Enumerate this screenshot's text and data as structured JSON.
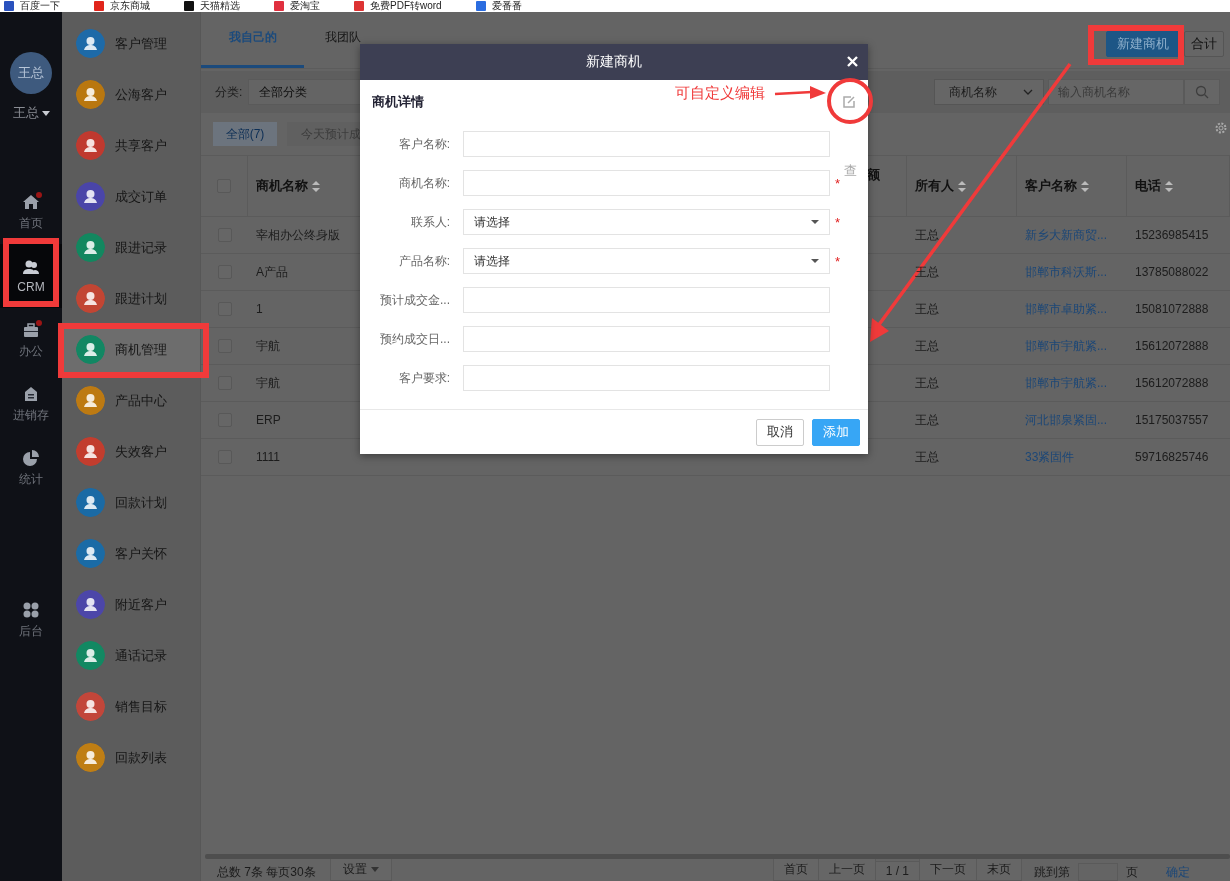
{
  "bookmarks": [
    {
      "label": "百度一下"
    },
    {
      "label": "京东商城"
    },
    {
      "label": "天猫精选"
    },
    {
      "label": "爱淘宝"
    },
    {
      "label": "免费PDF转word"
    },
    {
      "label": "爱番番"
    }
  ],
  "rail": {
    "avatar": "王总",
    "user": "王总",
    "nav": [
      {
        "label": "首页",
        "selected": false,
        "badge": true
      },
      {
        "label": "CRM",
        "selected": true,
        "badge": false
      },
      {
        "label": "办公",
        "selected": false,
        "badge": true
      },
      {
        "label": "进销存",
        "selected": false,
        "badge": false
      },
      {
        "label": "统计",
        "selected": false,
        "badge": false
      },
      {
        "label": "后台",
        "selected": false,
        "badge": false
      }
    ]
  },
  "menu": [
    {
      "label": "客户管理",
      "color": "#1d6aa8",
      "selected": false
    },
    {
      "label": "公海客户",
      "color": "#b9770f",
      "selected": false
    },
    {
      "label": "共享客户",
      "color": "#c0392f",
      "selected": false
    },
    {
      "label": "成交订单",
      "color": "#4a45a8",
      "selected": false
    },
    {
      "label": "跟进记录",
      "color": "#12875f",
      "selected": false
    },
    {
      "label": "跟进计划",
      "color": "#c24533",
      "selected": false
    },
    {
      "label": "商机管理",
      "color": "#128763",
      "selected": true
    },
    {
      "label": "产品中心",
      "color": "#bd7a12",
      "selected": false
    },
    {
      "label": "失效客户",
      "color": "#c23d2e",
      "selected": false
    },
    {
      "label": "回款计划",
      "color": "#1a6aa5",
      "selected": false
    },
    {
      "label": "客户关怀",
      "color": "#1a6ba6",
      "selected": false
    },
    {
      "label": "附近客户",
      "color": "#4c46a9",
      "selected": false
    },
    {
      "label": "通话记录",
      "color": "#128862",
      "selected": false
    },
    {
      "label": "销售目标",
      "color": "#c2463a",
      "selected": false
    },
    {
      "label": "回款列表",
      "color": "#bf7e14",
      "selected": false
    }
  ],
  "tabs": [
    {
      "label": "我自己的",
      "selected": true
    },
    {
      "label": "我团队",
      "selected": false
    }
  ],
  "actions": [
    {
      "label": "新建商机",
      "primary": true
    },
    {
      "label": "合计",
      "primary": false
    }
  ],
  "filter": {
    "label": "分类:",
    "value": "全部分类"
  },
  "search": {
    "field": "商机名称",
    "placeholder": "输入商机名称"
  },
  "quick_filters": [
    {
      "label": "全部(7)",
      "selected": true
    },
    {
      "label": "今天预计成",
      "selected": false
    }
  ],
  "table": {
    "select_all": false,
    "columns": [
      {
        "label": "商机名称",
        "sortable": true
      },
      {
        "label": "额",
        "sortable": false
      },
      {
        "label": "所有人",
        "sortable": true
      },
      {
        "label": "客户名称",
        "sortable": true
      },
      {
        "label": "电话",
        "sortable": true
      }
    ],
    "rows": [
      {
        "checked": false,
        "name": "宰相办公终身版",
        "owner": "王总",
        "customer": "新乡大新商贸...",
        "phone": "15236985415"
      },
      {
        "checked": false,
        "name": "A产品",
        "owner": "王总",
        "customer": "邯郸市科沃斯...",
        "phone": "13785088022"
      },
      {
        "checked": false,
        "name": "1",
        "owner": "王总",
        "customer": "邯郸市卓助紧...",
        "phone": "15081072888"
      },
      {
        "checked": false,
        "name": "宇航",
        "owner": "王总",
        "customer": "邯郸市宇航紧...",
        "phone": "15612072888"
      },
      {
        "checked": false,
        "name": "宇航",
        "owner": "王总",
        "customer": "邯郸市宇航紧...",
        "phone": "15612072888"
      },
      {
        "checked": false,
        "name": "ERP",
        "owner": "王总",
        "customer": "河北邯泉紧固...",
        "phone": "15175037557"
      },
      {
        "checked": false,
        "name": "1111",
        "owner": "王总",
        "customer": "33紧固件",
        "phone": "59716825746"
      }
    ]
  },
  "pagination": {
    "summary": "总数 7条 每页30条",
    "settings": "设置",
    "pages": [
      "首页",
      "上一页",
      "1 / 1",
      "下一页",
      "末页"
    ],
    "jump_label": "跳到第",
    "jump_unit": "页",
    "confirm": "确定"
  },
  "dialog": {
    "title": "新建商机",
    "section": "商机详情",
    "fields": [
      {
        "label": "客户名称:",
        "kind": "text"
      },
      {
        "label": "商机名称:",
        "kind": "text",
        "marker": "*",
        "extra": "查"
      },
      {
        "label": "联系人:",
        "kind": "select",
        "value": "请选择",
        "marker": "*"
      },
      {
        "label": "产品名称:",
        "kind": "select",
        "value": "请选择",
        "marker": "*"
      },
      {
        "label": "预计成交金...",
        "kind": "text"
      },
      {
        "label": "预约成交日...",
        "kind": "text"
      },
      {
        "label": "客户要求:",
        "kind": "text"
      }
    ],
    "buttons": [
      {
        "label": "取消",
        "primary": false
      },
      {
        "label": "添加",
        "primary": true
      }
    ]
  },
  "annotation": {
    "label": "可自定义编辑"
  }
}
